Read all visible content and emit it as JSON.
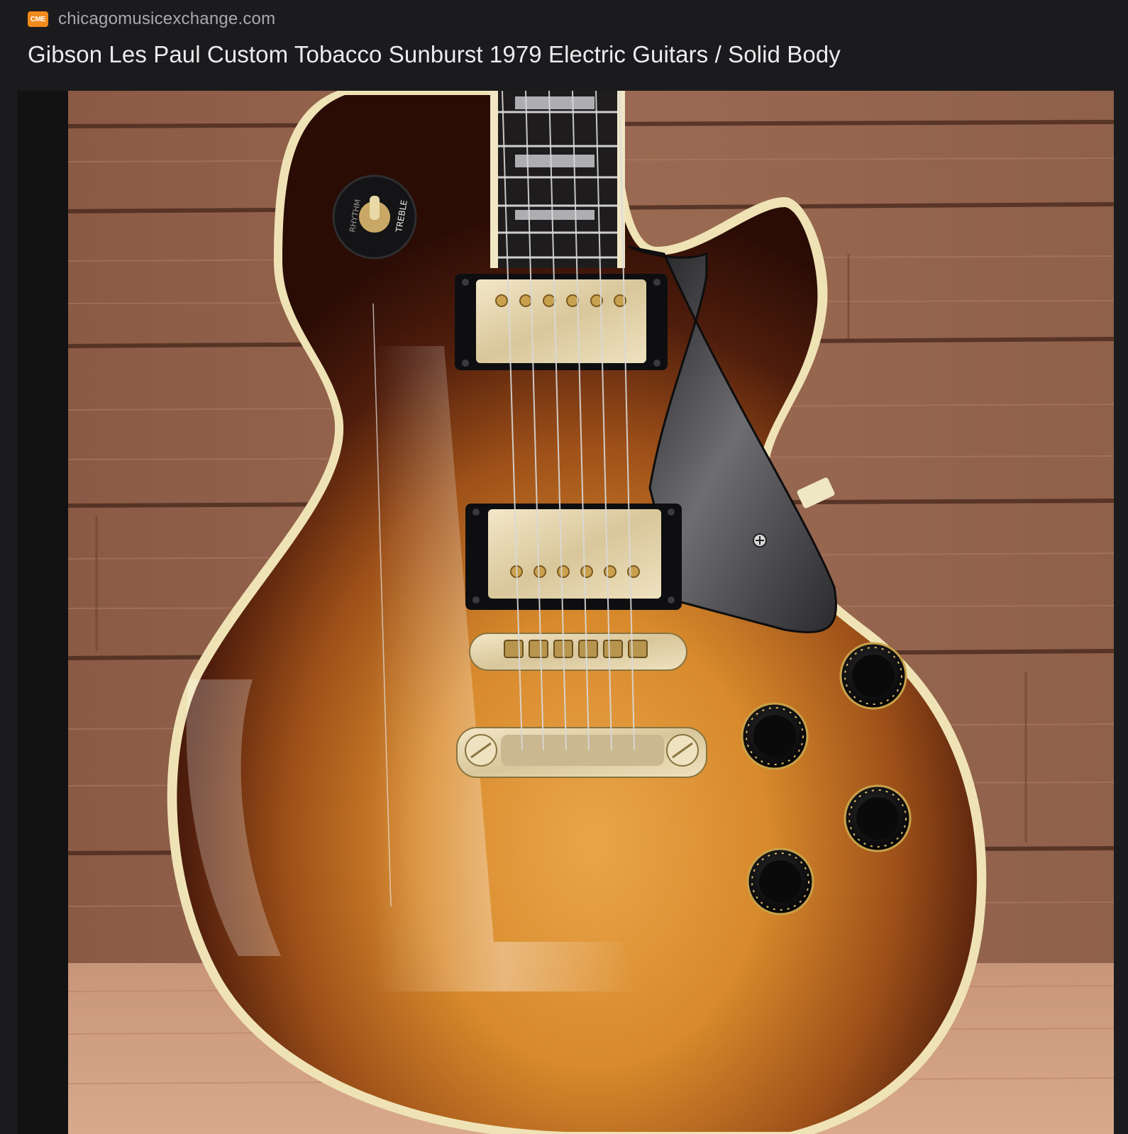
{
  "source": {
    "favicon_text": "CME",
    "favicon_color": "#f28a1c",
    "domain": "chicagomusicexchange.com"
  },
  "title": "Gibson Les Paul Custom Tobacco Sunburst 1979 Electric Guitars / Solid Body",
  "image": {
    "subject": "guitar-photo",
    "toggle_label_rhythm": "RHYTHM",
    "toggle_label_treble": "TREBLE"
  },
  "colors": {
    "background": "#1b1b1d",
    "title_text": "#ececee",
    "domain_text": "#a9a9ad"
  }
}
